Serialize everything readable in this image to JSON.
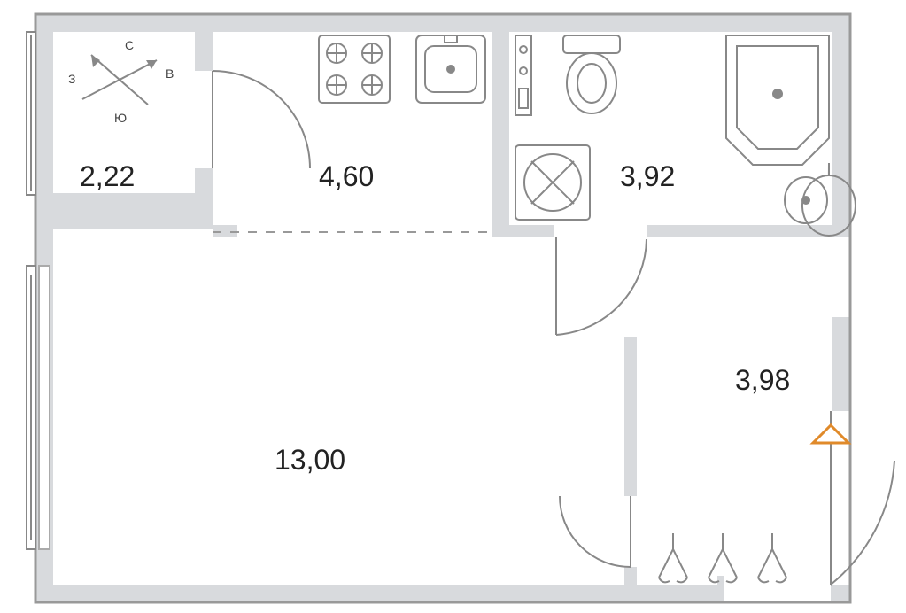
{
  "compass": {
    "n": "С",
    "e": "В",
    "s": "Ю",
    "w": "З"
  },
  "rooms": {
    "balcony": {
      "area": "2,22"
    },
    "kitchen": {
      "area": "4,60"
    },
    "bathroom": {
      "area": "3,92"
    },
    "living": {
      "area": "13,00"
    },
    "hallway": {
      "area": "3,98"
    }
  },
  "fixtures": {
    "balcony": [
      "compass"
    ],
    "kitchen": [
      "stove-4-burner",
      "sink"
    ],
    "bathroom": [
      "toilet",
      "shower-corner",
      "washing-machine",
      "washbasin"
    ],
    "hallway": [
      "entry-door",
      "coat-hooks-3"
    ]
  },
  "colors": {
    "wall": "#d8dadd",
    "line": "#888888",
    "text": "#222222",
    "accent": "#e08a2a"
  }
}
